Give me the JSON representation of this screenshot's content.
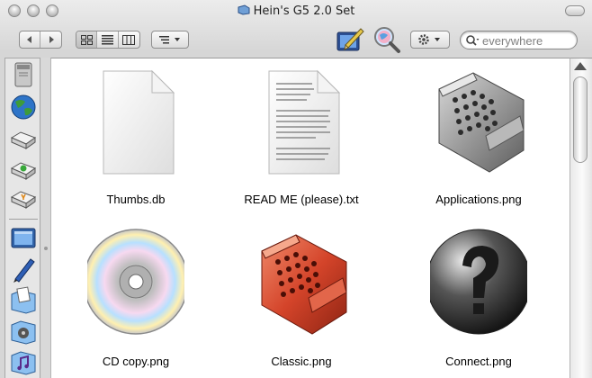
{
  "window": {
    "title": "Hein's G5 2.0 Set"
  },
  "toolbar": {
    "back_icon": "back-arrow-icon",
    "forward_icon": "forward-arrow-icon",
    "view_modes": [
      "icon-view",
      "list-view",
      "column-view"
    ],
    "active_view": "icon-view",
    "arrange_icon": "arrange-icon",
    "action_icon": "gear-icon",
    "custom_buttons": [
      "pencil-drawing-icon",
      "magnifier-globe-icon"
    ],
    "search": {
      "placeholder": "everywhere",
      "value": ""
    }
  },
  "sidebar": {
    "items": [
      {
        "name": "computer",
        "icon": "computer-tower-icon"
      },
      {
        "name": "network",
        "icon": "globe-icon"
      },
      {
        "name": "disk",
        "icon": "hard-drive-icon"
      },
      {
        "name": "disk-green",
        "icon": "disk-green-icon"
      },
      {
        "name": "disk-orange",
        "icon": "disk-orange-icon"
      },
      {
        "name": "desktop",
        "icon": "desktop-monitor-icon"
      },
      {
        "name": "pen",
        "icon": "pen-icon"
      },
      {
        "name": "documents",
        "icon": "documents-folder-icon"
      },
      {
        "name": "movies",
        "icon": "movies-folder-icon"
      },
      {
        "name": "music",
        "icon": "music-folder-icon"
      }
    ]
  },
  "files": [
    {
      "label": "Thumbs.db",
      "icon": "blank-document-icon"
    },
    {
      "label": "READ ME (please).txt",
      "icon": "text-document-icon"
    },
    {
      "label": "Applications.png",
      "icon": "applications-folder-icon"
    },
    {
      "label": "CD copy.png",
      "icon": "cd-icon"
    },
    {
      "label": "Classic.png",
      "icon": "classic-folder-icon"
    },
    {
      "label": "Connect.png",
      "icon": "connect-question-icon"
    }
  ],
  "colors": {
    "accent": "#3a74d8",
    "classic_red": "#d4442a",
    "folder_gray": "#8c8c8c"
  }
}
